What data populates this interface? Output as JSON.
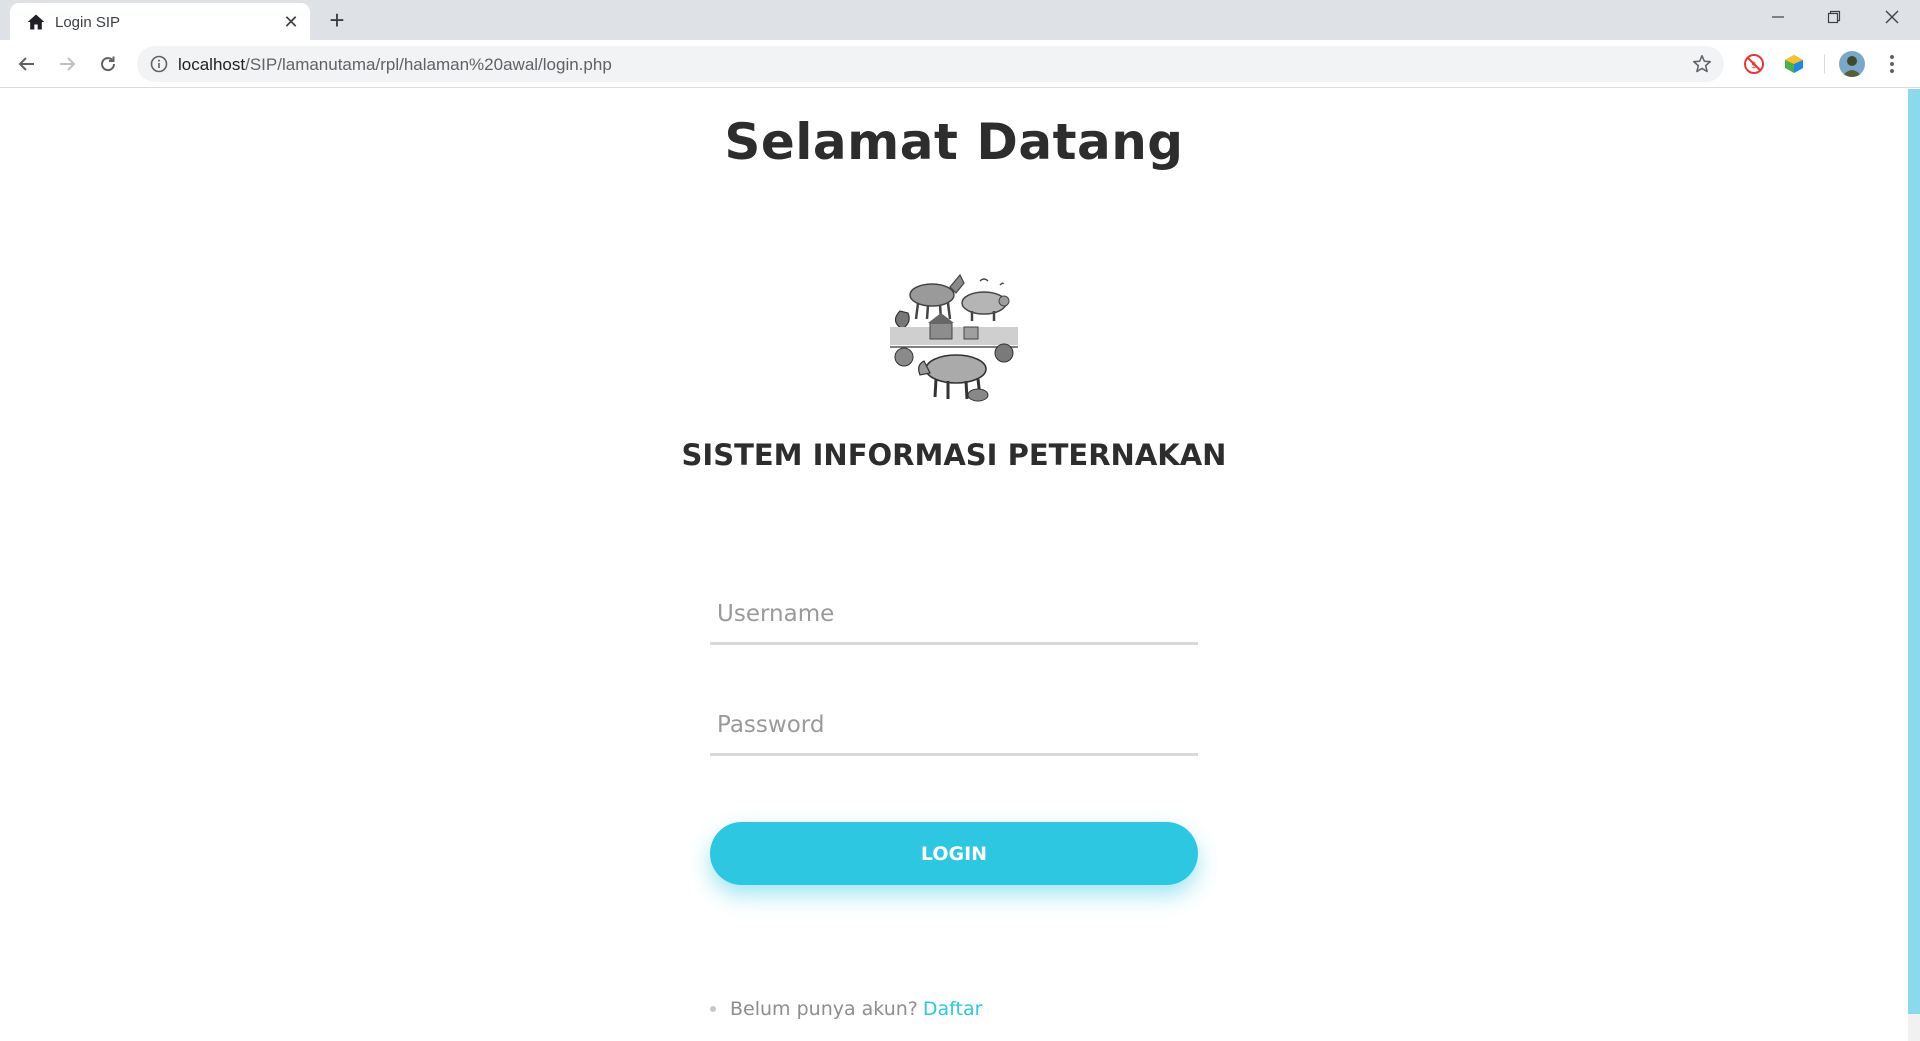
{
  "browser": {
    "tab_title": "Login SIP",
    "new_tab_symbol": "+",
    "url_host": "localhost",
    "url_path": "/SIP/lamanutama/rpl/halaman%20awal/login.php"
  },
  "page": {
    "welcome_title": "Selamat Datang",
    "app_name": "SISTEM INFORMASI PETERNAKAN",
    "username_placeholder": "Username",
    "password_placeholder": "Password",
    "login_label": "LOGIN",
    "signup_prompt": "Belum punya akun?",
    "signup_link": "Daftar"
  },
  "colors": {
    "accent": "#2ec7e2",
    "heading": "#2d2d2d",
    "placeholder": "#9a9a9a"
  }
}
